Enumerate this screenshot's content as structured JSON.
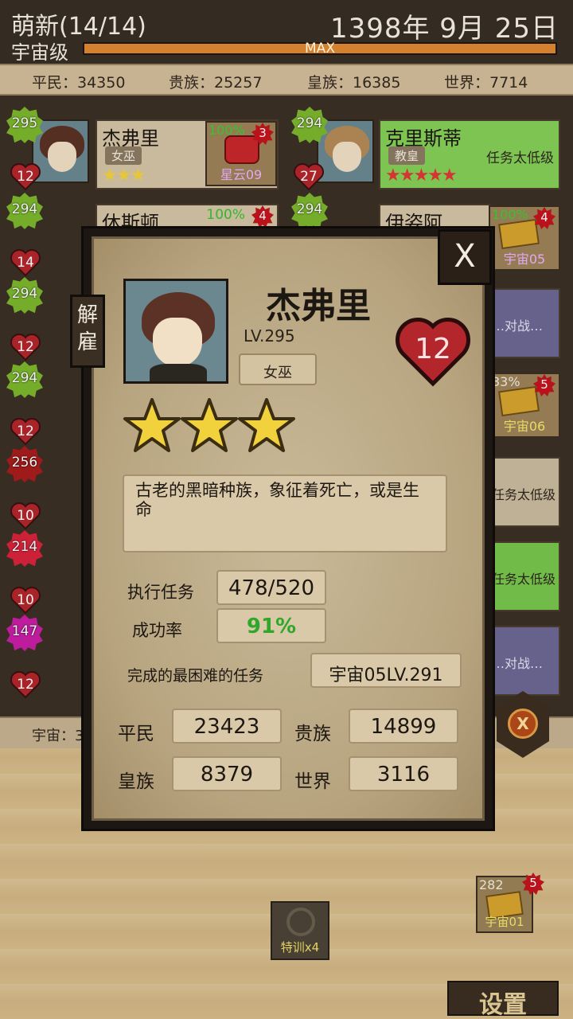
{
  "header": {
    "guild": "萌新(14/14)",
    "rank": "宇宙级",
    "date": "1398年 9月 25日",
    "xp_label": "MAX",
    "xp_fraction": 1.0
  },
  "population": {
    "commoner": "平民：34350",
    "noble": "贵族：25257",
    "royal": "皇族：16385",
    "world": "世界：7714"
  },
  "roster": [
    {
      "name": "杰弗里",
      "class": "女巫",
      "level": "295",
      "heart": "12",
      "stars": "★★★",
      "pct": "100%",
      "task": "星云09",
      "count": "3"
    },
    {
      "name": "克里斯蒂",
      "class": "教皇",
      "level": "294",
      "heart": "27",
      "stars": "★★★★★",
      "note": "任务太低级"
    },
    {
      "name": "休斯顿",
      "level": "294",
      "heart": "14",
      "pct": "100%",
      "count": "4"
    },
    {
      "name": "伊姿阿",
      "level": "294",
      "pct": "100%",
      "task": "宇宙05",
      "count": "4"
    }
  ],
  "left_column": [
    {
      "level": "294",
      "heart": "12"
    },
    {
      "level": "294",
      "heart": "12"
    },
    {
      "level": "256",
      "heart": "10"
    },
    {
      "level": "214",
      "heart": "10"
    },
    {
      "level": "147",
      "heart": "12"
    }
  ],
  "right_column": [
    {
      "text": "…对战…"
    },
    {
      "pct": "33%",
      "task": "宇宙06",
      "count": "5"
    },
    {
      "text": "任务太低级"
    },
    {
      "text": "任务太低级"
    },
    {
      "text": "…对战…"
    }
  ],
  "bottom": {
    "strip_text": "宇宙：3",
    "training": "特训x4",
    "quest_num": "282",
    "quest_label": "宇宙01",
    "quest_count": "5",
    "settings": "设置",
    "emblem": "X"
  },
  "modal": {
    "close": "X",
    "dismiss": "解雇",
    "name": "杰弗里",
    "level": "LV.295",
    "class": "女巫",
    "heart": "12",
    "stars": 3,
    "description": "古老的黑暗种族，象征着死亡，或是生命",
    "tasks_label": "执行任务",
    "tasks_value": "478/520",
    "success_label": "成功率",
    "success_value": "91%",
    "hardest_label": "完成的最困难的任务",
    "hardest_value": "宇宙05LV.291",
    "commoner_label": "平民",
    "commoner_value": "23423",
    "noble_label": "贵族",
    "noble_value": "14899",
    "royal_label": "皇族",
    "royal_value": "8379",
    "world_label": "世界",
    "world_value": "3116"
  },
  "colors": {
    "accent_green": "#7cb72e",
    "heart_red": "#b3262c",
    "success_green": "#2fa82a",
    "xp_orange": "#d3802f"
  }
}
